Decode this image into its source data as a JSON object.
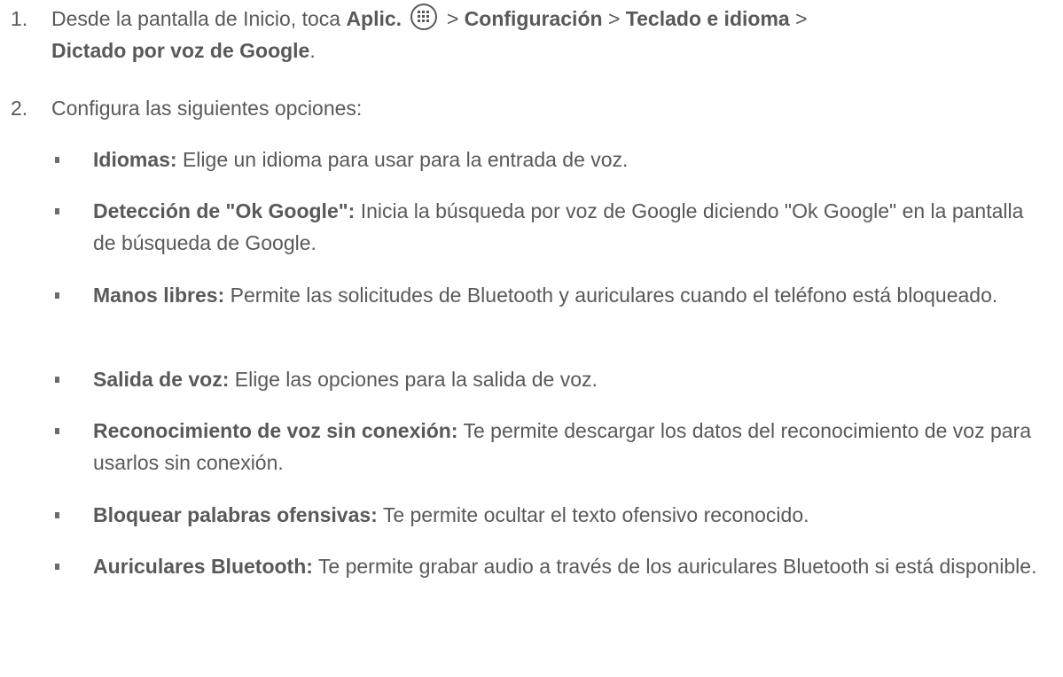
{
  "step1": {
    "number": "1.",
    "prefix": "Desde la pantalla de Inicio, toca ",
    "apps_label": "Aplic.",
    "sep1": " > ",
    "settings_label": "Configuración",
    "sep2": " > ",
    "keyboard_label": "Teclado e idioma",
    "sep3": " >",
    "voice_label": "Dictado por voz de Google",
    "end": "."
  },
  "step2": {
    "number": "2.",
    "text": "Configura las siguientes opciones:"
  },
  "options": [
    {
      "term": "Idiomas:",
      "desc": " Elige un idioma para usar para la entrada de voz."
    },
    {
      "term": "Detección de \"Ok Google\":",
      "desc": " Inicia la búsqueda por voz de Google diciendo \"Ok Google\" en la pantalla de búsqueda de Google."
    },
    {
      "term": "Manos libres:",
      "desc": " Permite las solicitudes de Bluetooth y auriculares cuando el teléfono está bloqueado."
    },
    {
      "term": "Salida de voz:",
      "desc": " Elige las opciones para la salida de voz."
    },
    {
      "term": "Reconocimiento de voz sin conexión:",
      "desc": " Te permite descargar los datos del reconocimiento de voz para usarlos sin conexión."
    },
    {
      "term": "Bloquear palabras ofensivas:",
      "desc": " Te permite ocultar el texto ofensivo reconocido."
    },
    {
      "term": "Auriculares Bluetooth:",
      "desc": " Te permite grabar audio a través de los auriculares Bluetooth si está disponible."
    }
  ],
  "icons": {
    "apps": "apps-grid-icon",
    "bullet": "square-bullet-icon"
  }
}
